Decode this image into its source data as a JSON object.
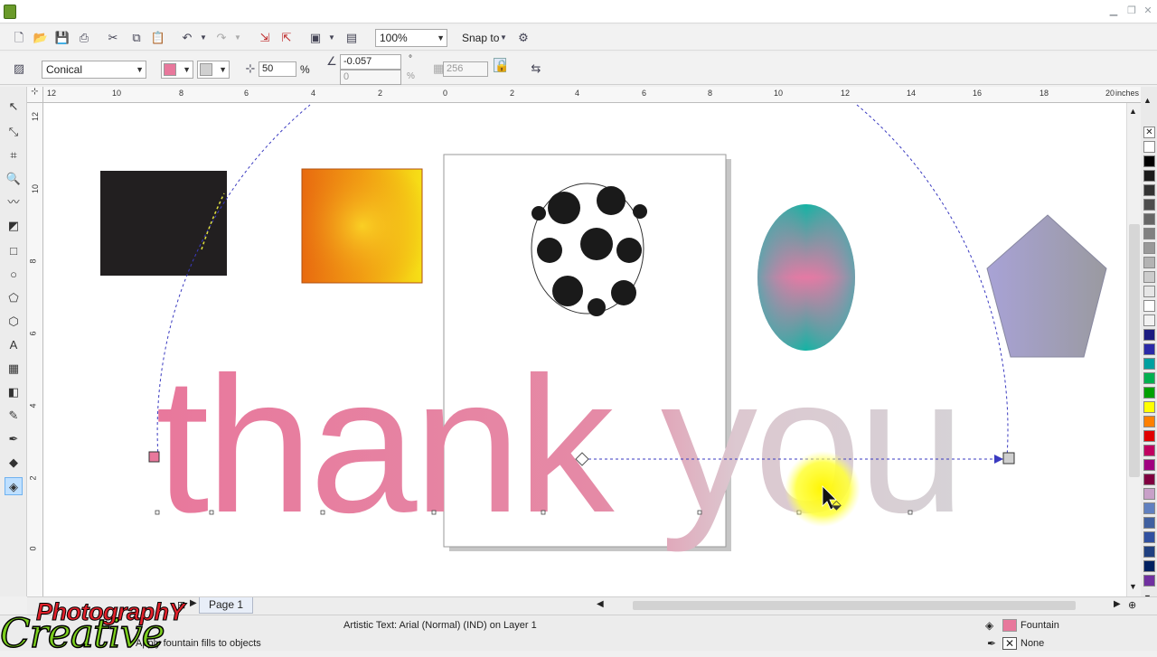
{
  "window": {
    "minimize": "▫",
    "restore": "▫",
    "close": "✕"
  },
  "toolbar1": {
    "zoom": "100%",
    "snap_to": "Snap to"
  },
  "toolbar2": {
    "fill_type": "Conical",
    "midpoint": "50",
    "midpoint_unit": "%",
    "angle": "-0.057",
    "angle_unit": "°",
    "edge_pad": "0",
    "edge_pad_unit": "%",
    "steps": "256"
  },
  "ruler": {
    "unit": "inches",
    "top_ticks": [
      "12",
      "10",
      "8",
      "6",
      "4",
      "2",
      "0",
      "2",
      "4",
      "6",
      "8",
      "10",
      "12",
      "14",
      "16",
      "18",
      "20"
    ],
    "left_ticks": [
      "12",
      "10",
      "8",
      "6",
      "4",
      "2",
      "0"
    ]
  },
  "canvas": {
    "text_artwork": "thank you"
  },
  "page_tab": {
    "label": "Page 1"
  },
  "status": {
    "object_info": "Artistic Text: Arial (Normal) (IND) on Layer 1",
    "hint": "Apply fountain fills to objects",
    "fill_label": "Fountain",
    "outline_label": "None"
  },
  "watermark": {
    "line1": "PhotographY",
    "line2": "Creative"
  },
  "palette": {
    "colors": [
      "#ffffff",
      "#000000",
      "#1a1a1a",
      "#333333",
      "#4d4d4d",
      "#666666",
      "#808080",
      "#999999",
      "#b3b3b3",
      "#cccccc",
      "#e6e6e6",
      "#ffffff",
      "#f2f2f2",
      "#1a1a80",
      "#2a2aa8",
      "#00a0a0",
      "#00b050",
      "#00a000",
      "#ffff00",
      "#ff8000",
      "#e00000",
      "#c00060",
      "#a00080",
      "#800040",
      "#c8a0c8",
      "#6080c0",
      "#4060a0",
      "#3050a0",
      "#204080",
      "#002060",
      "#7030a0"
    ]
  },
  "colors": {
    "text_pink": "#e8789c",
    "accent": "#3a6fd8"
  }
}
